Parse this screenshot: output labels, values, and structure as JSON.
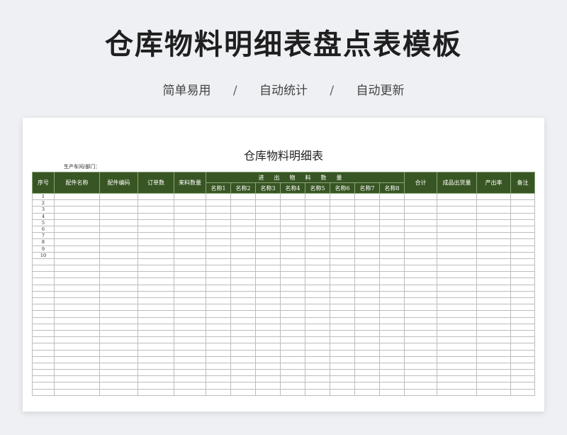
{
  "page": {
    "title": "仓库物料明细表盘点表模板",
    "features": [
      "简单易用",
      "自动统计",
      "自动更新"
    ],
    "separator": "/"
  },
  "sheet": {
    "title": "仓库物料明细表",
    "dept_label": "生产车间/部门：",
    "header_fixed_left": [
      "序号",
      "配件名称",
      "配件编码",
      "订单数",
      "来料数量"
    ],
    "group_header": "进出物料数量",
    "sub_headers": [
      "名称1",
      "名称2",
      "名称3",
      "名称4",
      "名称5",
      "名称6",
      "名称7",
      "名称8"
    ],
    "header_fixed_right": [
      "合计",
      "成品出货量",
      "产出率",
      "备注"
    ],
    "row_numbers": [
      "1",
      "2",
      "3",
      "4",
      "5",
      "6",
      "7",
      "8",
      "9",
      "10"
    ],
    "total_rows": 31
  },
  "colors": {
    "header_bg": "#385623",
    "page_bg": "#eef0f3",
    "paper_bg": "#ffffff"
  }
}
